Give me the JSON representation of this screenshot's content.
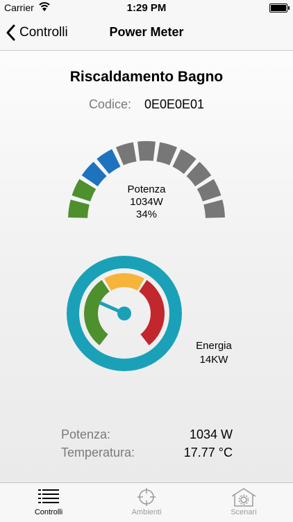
{
  "status_bar": {
    "carrier": "Carrier",
    "time": "1:29 PM",
    "battery_level": 1.0
  },
  "nav": {
    "back_label": "Controlli",
    "title": "Power Meter"
  },
  "device": {
    "name": "Riscaldamento Bagno",
    "code_label": "Codice:",
    "code_value": "0E0E0E01"
  },
  "power_gauge": {
    "label": "Potenza",
    "value": "1034W",
    "percent_text": "34%",
    "level": 0.34,
    "segment_count": 11,
    "colors": {
      "low": "#4e8f2e",
      "mid": "#1e73be",
      "inactive": "#777777"
    }
  },
  "energy_gauge": {
    "label": "Energia",
    "value": "14KW",
    "colors": {
      "ring": "#1aa1b8",
      "green": "#4e8f2e",
      "yellow": "#f6b53a",
      "red": "#c1272d",
      "needle": "#1aa1b8"
    }
  },
  "readings": [
    {
      "label": "Potenza:",
      "value": "1034 W"
    },
    {
      "label": "Temperatura:",
      "value": "17.77 °C"
    }
  ],
  "tabs": [
    {
      "label": "Controlli",
      "icon": "list-icon",
      "active": true
    },
    {
      "label": "Ambienti",
      "icon": "crosshair-icon",
      "active": false
    },
    {
      "label": "Scenari",
      "icon": "house-gear-icon",
      "active": false
    }
  ]
}
